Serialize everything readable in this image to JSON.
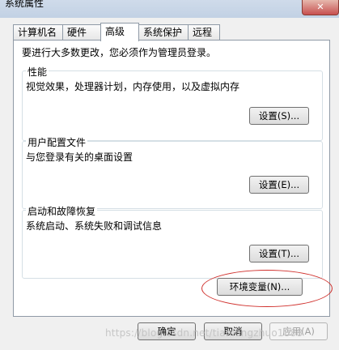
{
  "window": {
    "title": "系统属性",
    "close_label": "✕"
  },
  "tabs": [
    {
      "label": "计算机名"
    },
    {
      "label": "硬件"
    },
    {
      "label": "高级"
    },
    {
      "label": "系统保护"
    },
    {
      "label": "远程"
    }
  ],
  "panel": {
    "admin_note": "要进行大多数更改，您必须作为管理员登录。",
    "performance": {
      "title": "性能",
      "desc": "视觉效果，处理器计划，内存使用，以及虚拟内存",
      "button": "设置(S)..."
    },
    "user_profiles": {
      "title": "用户配置文件",
      "desc": "与您登录有关的桌面设置",
      "button": "设置(E)..."
    },
    "startup_recovery": {
      "title": "启动和故障恢复",
      "desc": "系统启动、系统失败和调试信息",
      "button": "设置(T)..."
    },
    "env_button": "环境变量(N)..."
  },
  "footer": {
    "ok": "确定",
    "cancel": "取消",
    "apply": "应用(A)"
  },
  "watermark": "https://blog.csdn.net/tianlongzhuo1888",
  "colors": {
    "annotation_circle": "#d0302c"
  }
}
